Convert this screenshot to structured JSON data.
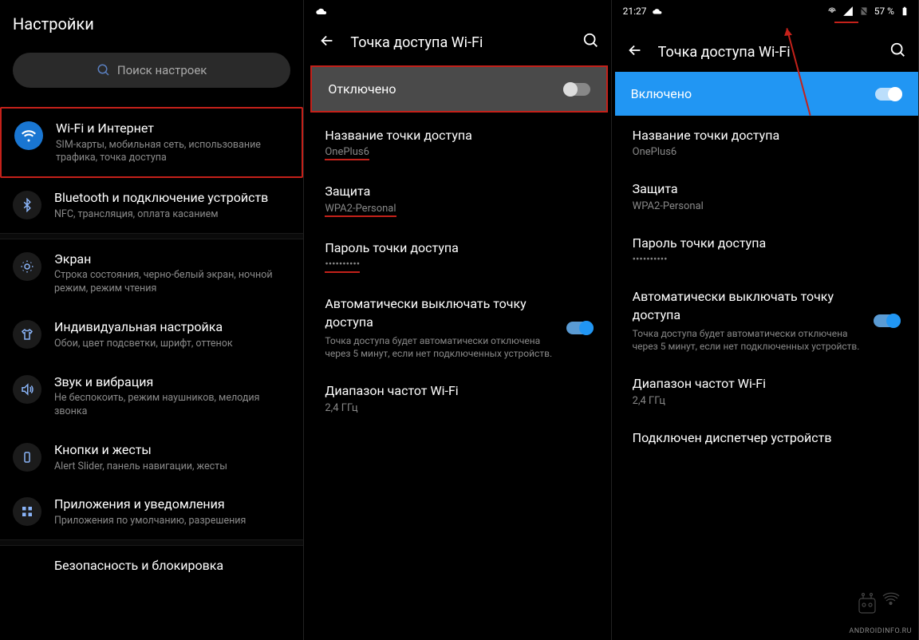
{
  "panel1": {
    "title": "Настройки",
    "search_placeholder": "Поиск настроек",
    "items": [
      {
        "title": "Wi-Fi и Интернет",
        "sub": "SIM-карты, мобильная сеть, использование трафика, точка доступа"
      },
      {
        "title": "Bluetooth и подключение устройств",
        "sub": "NFC, трансляция, оплата касанием"
      },
      {
        "title": "Экран",
        "sub": "Строка состояния, черно-белый экран, ночной режим, режим чтения"
      },
      {
        "title": "Индивидуальная настройка",
        "sub": "Обои, цвет подсветки, шрифт, оттенок"
      },
      {
        "title": "Звук и вибрация",
        "sub": "Не беспокоить, режим наушников, мелодия звонка"
      },
      {
        "title": "Кнопки и жесты",
        "sub": "Alert Slider, панель навигации, жесты"
      },
      {
        "title": "Приложения и уведомления",
        "sub": "Приложения по умолчанию, разрешения"
      },
      {
        "title": "Безопасность и блокировка",
        "sub": ""
      }
    ]
  },
  "panel2": {
    "header": "Точка доступа Wi-Fi",
    "toggle_label": "Отключено",
    "hotspot_name_label": "Название точки доступа",
    "hotspot_name_value": "OnePlus6",
    "security_label": "Защита",
    "security_value": "WPA2-Personal",
    "password_label": "Пароль точки доступа",
    "password_value": "••••••••••",
    "auto_off_title": "Автоматически выключать точку доступа",
    "auto_off_desc": "Точка доступа будет автоматически отключена через 5 минут, если нет подключенных устройств.",
    "band_label": "Диапазон частот Wi-Fi",
    "band_value": "2,4 ГГц"
  },
  "panel3": {
    "status_time": "21:27",
    "status_battery": "57 %",
    "header": "Точка доступа Wi-Fi",
    "toggle_label": "Включено",
    "hotspot_name_label": "Название точки доступа",
    "hotspot_name_value": "OnePlus6",
    "security_label": "Защита",
    "security_value": "WPA2-Personal",
    "password_label": "Пароль точки доступа",
    "password_value": "••••••••••",
    "auto_off_title": "Автоматически выключать точку доступа",
    "auto_off_desc": "Точка доступа будет автоматически отключена через 5 минут, если нет подключенных устройств.",
    "band_label": "Диапазон частот Wi-Fi",
    "band_value": "2,4 ГГц",
    "dispatcher_label": "Подключен диспетчер устройств"
  },
  "watermark": "ANDROIDINFO.RU"
}
